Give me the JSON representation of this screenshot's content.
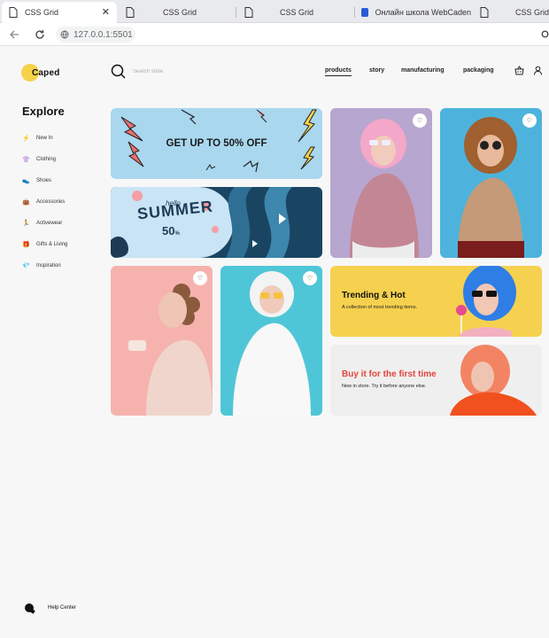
{
  "browser": {
    "tabs": [
      {
        "title": "CSS Grid",
        "active": true,
        "close": "✕"
      },
      {
        "title": "CSS Grid",
        "active": false
      },
      {
        "title": "CSS Grid",
        "active": false
      },
      {
        "title": "Онлайн школа WebCaden",
        "active": false
      },
      {
        "title": "CSS Grid",
        "active": false
      }
    ],
    "url": "127.0.0.1:5501",
    "back_icon": "back-arrow-icon",
    "reload_icon": "reload-icon"
  },
  "header": {
    "logo_text": "Caped",
    "search_placeholder": "Search store",
    "nav": [
      "products",
      "story",
      "manufacturing",
      "packaging"
    ],
    "active_nav": "products",
    "icons": [
      "basket-icon",
      "user-icon"
    ]
  },
  "sidebar": {
    "title": "Explore",
    "items": [
      {
        "label": "New In",
        "icon": "⚡"
      },
      {
        "label": "Clothing",
        "icon": "👚"
      },
      {
        "label": "Shoes",
        "icon": "👟"
      },
      {
        "label": "Accessories",
        "icon": "👜"
      },
      {
        "label": "Activewear",
        "icon": "🏃"
      },
      {
        "label": "Gifts & Living",
        "icon": "🎁"
      },
      {
        "label": "Inspiration",
        "icon": "💎"
      }
    ],
    "help_label": "Help Center"
  },
  "grid": {
    "promo_sale": "GET UP TO 50% OFF",
    "promo_summer": {
      "hello": "hello",
      "title": "SUMMER",
      "percent": "50",
      "percent_sign": "%"
    },
    "trending": {
      "title": "Trending & Hot",
      "subtitle": "A collection of most trending items."
    },
    "buy": {
      "title": "Buy it for the first time",
      "subtitle": "New in store. Try it before anyone else."
    },
    "heart_icon": "♡"
  },
  "colors": {
    "accent_yellow": "#f6d14f",
    "promo_blue": "#a9d7ee",
    "summer_navy": "#1a4562",
    "buy_title_red": "#e2453c"
  }
}
